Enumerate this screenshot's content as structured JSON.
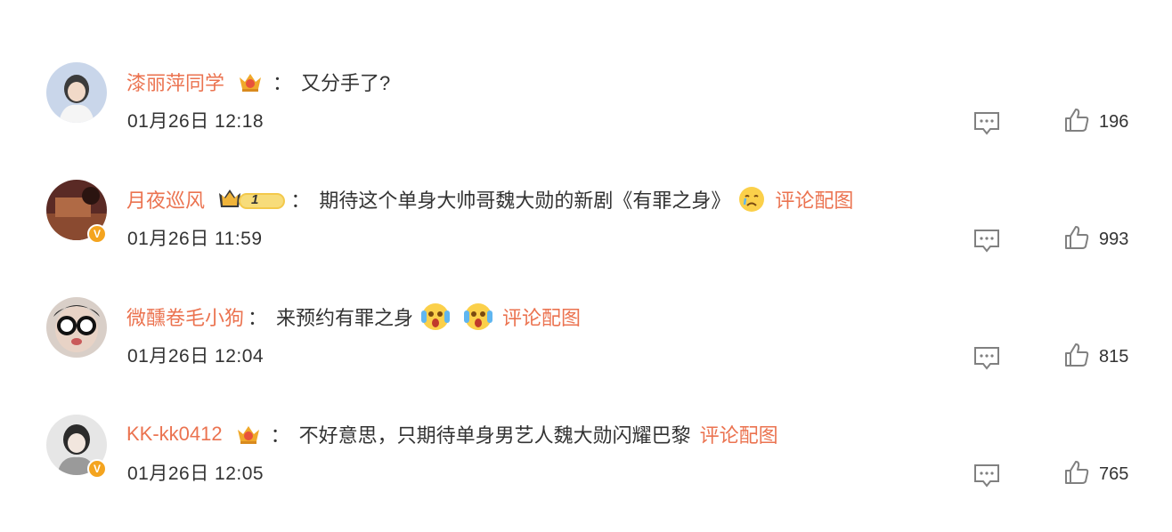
{
  "comments": [
    {
      "username": "漆丽萍同学",
      "separator": "：",
      "text": "又分手了?",
      "time": "01月26日 12:18",
      "likes": "196",
      "level_icon": "crown-badge-icon"
    },
    {
      "username": "月夜巡风",
      "separator": "：",
      "text": "期待这个单身大帅哥魏大勋的新剧《有罪之身》",
      "picture_link": "评论配图",
      "time": "01月26日 11:59",
      "likes": "993",
      "level_icon": "crown-level-1-badge-icon",
      "level_number": "1",
      "verified_badge": "V"
    },
    {
      "username": "微醺卷毛小狗",
      "separator": "：",
      "text": "来预约有罪之身",
      "picture_link": "评论配图",
      "time": "01月26日 12:04",
      "likes": "815"
    },
    {
      "username": "KK-kk0412",
      "separator": "：",
      "text": "不好意思，只期待单身男艺人魏大勋闪耀巴黎",
      "picture_link": "评论配图",
      "time": "01月26日 12:05",
      "likes": "765",
      "level_icon": "crown-badge-icon",
      "verified_badge": "V"
    }
  ],
  "colors": {
    "username": "#eb7350",
    "text": "#333333",
    "icon": "#808080",
    "verified": "#f4a41f"
  }
}
